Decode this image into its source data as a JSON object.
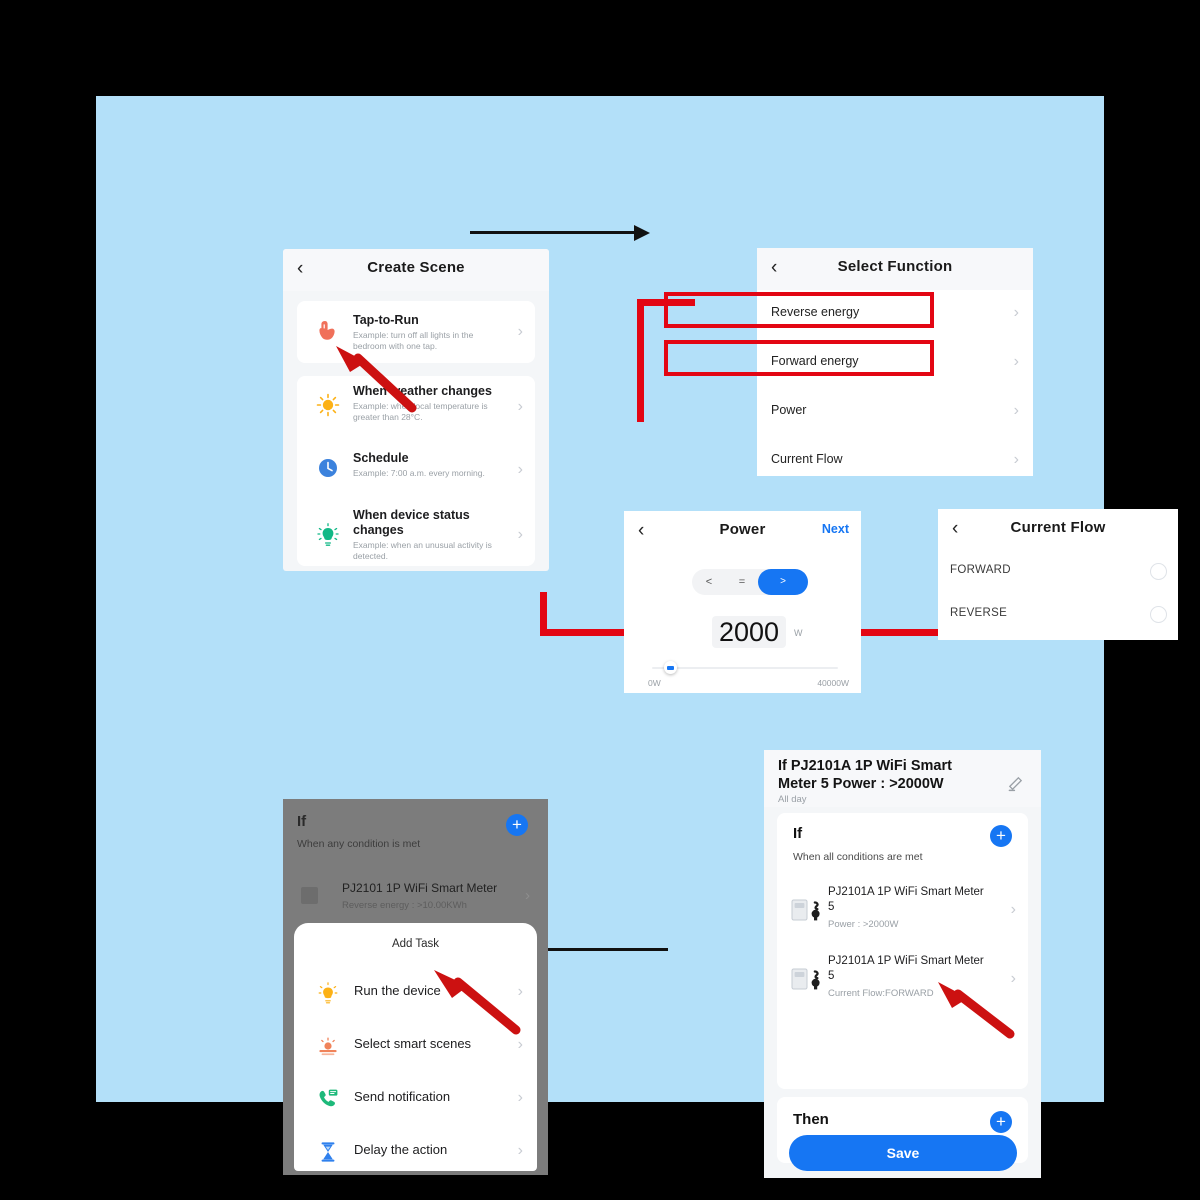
{
  "canvas": {
    "background": "#b3e0f9",
    "accent_blue": "#1676f3",
    "accent_red": "#e30613"
  },
  "create_scene": {
    "title": "Create Scene",
    "back_icon": "chevron-left-icon",
    "items": [
      {
        "icon": "tap-hand-icon",
        "title": "Tap-to-Run",
        "subtitle": "Example: turn off all lights in the bedroom with one tap."
      },
      {
        "icon": "sun-icon",
        "title": "When weather changes",
        "subtitle": "Example: when local temperature is greater than 28°C."
      },
      {
        "icon": "clock-icon",
        "title": "Schedule",
        "subtitle": "Example: 7:00 a.m. every morning."
      },
      {
        "icon": "sensor-icon",
        "title": "When device status changes",
        "subtitle": "Example: when an unusual activity is detected."
      }
    ]
  },
  "select_function": {
    "title": "Select Function",
    "back_icon": "chevron-left-icon",
    "items": [
      {
        "label": "Reverse energy",
        "highlighted": false
      },
      {
        "label": "Forward energy",
        "highlighted": false
      },
      {
        "label": "Power",
        "highlighted": true
      },
      {
        "label": "Current Flow",
        "highlighted": true
      }
    ]
  },
  "power": {
    "title": "Power",
    "back_icon": "chevron-left-icon",
    "next_label": "Next",
    "operators": [
      "<",
      "=",
      ">"
    ],
    "selected_operator": ">",
    "value": "2000",
    "unit": "W",
    "slider_min_label": "0W",
    "slider_max_label": "40000W",
    "slider_percent": 5
  },
  "current_flow": {
    "title": "Current Flow",
    "back_icon": "chevron-left-icon",
    "options": [
      "FORWARD",
      "REVERSE"
    ]
  },
  "summary": {
    "title": "If PJ2101A 1P WiFi Smart Meter  5 Power : >2000W",
    "all_day": "All day",
    "edit_icon": "pencil-icon",
    "if_heading": "If",
    "if_subtitle": "When all conditions are met",
    "add_icon": "plus-circle-icon",
    "conditions": [
      {
        "icon": "smart-meter-icon",
        "name": "PJ2101A 1P WiFi Smart Meter 5",
        "detail": "Power : >2000W"
      },
      {
        "icon": "smart-meter-icon",
        "name": "PJ2101A 1P WiFi Smart Meter 5",
        "detail": "Current Flow:FORWARD"
      }
    ],
    "then_heading": "Then",
    "add_task_label": "Add Task",
    "save_label": "Save"
  },
  "add_task": {
    "dim_if_heading": "If",
    "dim_if_subtitle": "When any condition is met",
    "dim_add_icon": "plus-circle-icon",
    "dim_condition": {
      "icon": "smart-meter-icon",
      "name": "PJ2101 1P WiFi Smart Meter",
      "detail": "Reverse energy : >10.00KWh"
    },
    "sheet_title": "Add Task",
    "items": [
      {
        "icon": "bulb-icon",
        "label": "Run the device"
      },
      {
        "icon": "scene-icon",
        "label": "Select smart scenes"
      },
      {
        "icon": "phone-notification-icon",
        "label": "Send notification"
      },
      {
        "icon": "hourglass-icon",
        "label": "Delay the action"
      }
    ]
  }
}
